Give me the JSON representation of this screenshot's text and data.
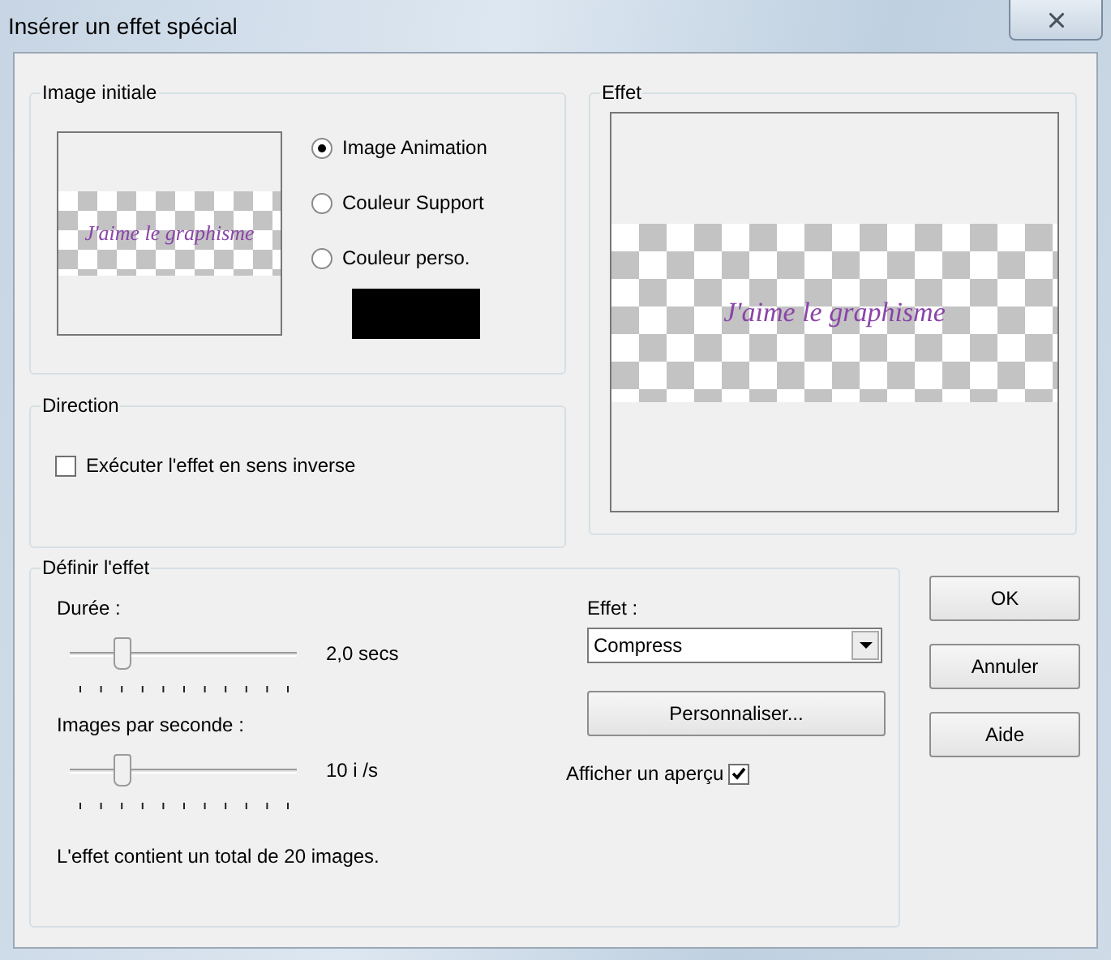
{
  "window": {
    "title": "Insérer un effet spécial"
  },
  "image_initiale": {
    "legend": "Image initiale",
    "preview_text": "J'aime le graphisme",
    "sources": [
      {
        "label": "Image Animation",
        "selected": true
      },
      {
        "label": "Couleur Support",
        "selected": false
      },
      {
        "label": "Couleur perso.",
        "selected": false
      }
    ]
  },
  "direction": {
    "legend": "Direction",
    "reverse": {
      "label": "Exécuter l'effet en sens inverse",
      "checked": false
    }
  },
  "effet": {
    "legend": "Effet",
    "preview_text": "J'aime le graphisme"
  },
  "define": {
    "legend": "Définir l'effet",
    "sliders": [
      {
        "label": "Durée :",
        "level": 0.2,
        "reading": "2,0 secs"
      },
      {
        "label": "Images par seconde :",
        "level": 0.2,
        "reading": "10 i /s"
      }
    ],
    "summary": "L'effet contient un total de 20 images.",
    "effect_label": "Effet :",
    "effect_value": "Compress",
    "customize": "Personnaliser...",
    "preview": {
      "label": "Afficher un aperçu",
      "checked": true
    }
  },
  "buttons": [
    "OK",
    "Annuler",
    "Aide"
  ]
}
